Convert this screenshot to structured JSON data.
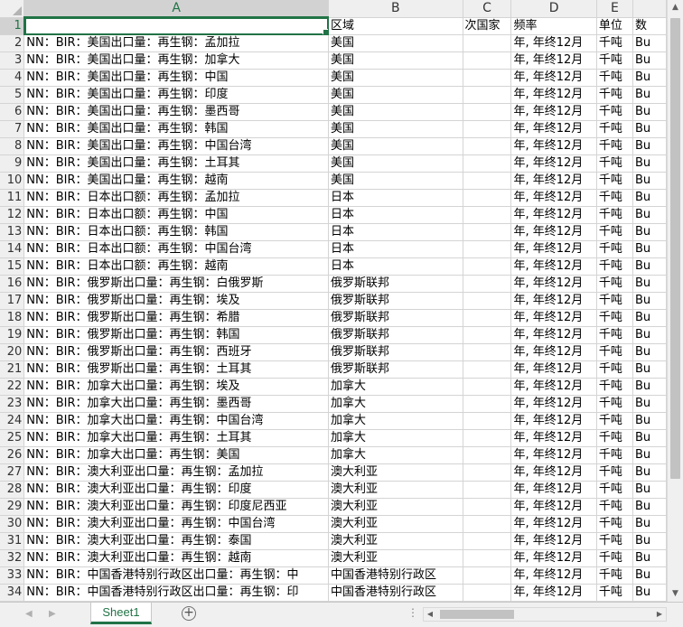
{
  "columns": [
    {
      "letter": "A",
      "active": true
    },
    {
      "letter": "B",
      "active": false
    },
    {
      "letter": "C",
      "active": false
    },
    {
      "letter": "D",
      "active": false
    },
    {
      "letter": "E",
      "active": false
    },
    {
      "letter": "",
      "active": false
    }
  ],
  "rows": [
    {
      "num": "1",
      "cells": [
        "",
        "区域",
        "次国家",
        "频率",
        "单位",
        "数"
      ]
    },
    {
      "num": "2",
      "cells": [
        "NN：BIR：美国出口量：再生钢：孟加拉",
        "美国",
        "",
        "年, 年终12月",
        "千吨",
        "Bu"
      ]
    },
    {
      "num": "3",
      "cells": [
        "NN：BIR：美国出口量：再生钢：加拿大",
        "美国",
        "",
        "年, 年终12月",
        "千吨",
        "Bu"
      ]
    },
    {
      "num": "4",
      "cells": [
        "NN：BIR：美国出口量：再生钢：中国",
        "美国",
        "",
        "年, 年终12月",
        "千吨",
        "Bu"
      ]
    },
    {
      "num": "5",
      "cells": [
        "NN：BIR：美国出口量：再生钢：印度",
        "美国",
        "",
        "年, 年终12月",
        "千吨",
        "Bu"
      ]
    },
    {
      "num": "6",
      "cells": [
        "NN：BIR：美国出口量：再生钢：墨西哥",
        "美国",
        "",
        "年, 年终12月",
        "千吨",
        "Bu"
      ]
    },
    {
      "num": "7",
      "cells": [
        "NN：BIR：美国出口量：再生钢：韩国",
        "美国",
        "",
        "年, 年终12月",
        "千吨",
        "Bu"
      ]
    },
    {
      "num": "8",
      "cells": [
        "NN：BIR：美国出口量：再生钢：中国台湾",
        "美国",
        "",
        "年, 年终12月",
        "千吨",
        "Bu"
      ]
    },
    {
      "num": "9",
      "cells": [
        "NN：BIR：美国出口量：再生钢：土耳其",
        "美国",
        "",
        "年, 年终12月",
        "千吨",
        "Bu"
      ]
    },
    {
      "num": "10",
      "cells": [
        "NN：BIR：美国出口量：再生钢：越南",
        "美国",
        "",
        "年, 年终12月",
        "千吨",
        "Bu"
      ]
    },
    {
      "num": "11",
      "cells": [
        "NN：BIR：日本出口额：再生钢：孟加拉",
        "日本",
        "",
        "年, 年终12月",
        "千吨",
        "Bu"
      ]
    },
    {
      "num": "12",
      "cells": [
        "NN：BIR：日本出口额：再生钢：中国",
        "日本",
        "",
        "年, 年终12月",
        "千吨",
        "Bu"
      ]
    },
    {
      "num": "13",
      "cells": [
        "NN：BIR：日本出口额：再生钢：韩国",
        "日本",
        "",
        "年, 年终12月",
        "千吨",
        "Bu"
      ]
    },
    {
      "num": "14",
      "cells": [
        "NN：BIR：日本出口额：再生钢：中国台湾",
        "日本",
        "",
        "年, 年终12月",
        "千吨",
        "Bu"
      ]
    },
    {
      "num": "15",
      "cells": [
        "NN：BIR：日本出口额：再生钢：越南",
        "日本",
        "",
        "年, 年终12月",
        "千吨",
        "Bu"
      ]
    },
    {
      "num": "16",
      "cells": [
        "NN：BIR：俄罗斯出口量：再生钢：白俄罗斯",
        "俄罗斯联邦",
        "",
        "年, 年终12月",
        "千吨",
        "Bu"
      ]
    },
    {
      "num": "17",
      "cells": [
        "NN：BIR：俄罗斯出口量：再生钢：埃及",
        "俄罗斯联邦",
        "",
        "年, 年终12月",
        "千吨",
        "Bu"
      ]
    },
    {
      "num": "18",
      "cells": [
        "NN：BIR：俄罗斯出口量：再生钢：希腊",
        "俄罗斯联邦",
        "",
        "年, 年终12月",
        "千吨",
        "Bu"
      ]
    },
    {
      "num": "19",
      "cells": [
        "NN：BIR：俄罗斯出口量：再生钢：韩国",
        "俄罗斯联邦",
        "",
        "年, 年终12月",
        "千吨",
        "Bu"
      ]
    },
    {
      "num": "20",
      "cells": [
        "NN：BIR：俄罗斯出口量：再生钢：西班牙",
        "俄罗斯联邦",
        "",
        "年, 年终12月",
        "千吨",
        "Bu"
      ]
    },
    {
      "num": "21",
      "cells": [
        "NN：BIR：俄罗斯出口量：再生钢：土耳其",
        "俄罗斯联邦",
        "",
        "年, 年终12月",
        "千吨",
        "Bu"
      ]
    },
    {
      "num": "22",
      "cells": [
        "NN：BIR：加拿大出口量：再生钢：埃及",
        "加拿大",
        "",
        "年, 年终12月",
        "千吨",
        "Bu"
      ]
    },
    {
      "num": "23",
      "cells": [
        "NN：BIR：加拿大出口量：再生钢：墨西哥",
        "加拿大",
        "",
        "年, 年终12月",
        "千吨",
        "Bu"
      ]
    },
    {
      "num": "24",
      "cells": [
        "NN：BIR：加拿大出口量：再生钢：中国台湾",
        "加拿大",
        "",
        "年, 年终12月",
        "千吨",
        "Bu"
      ]
    },
    {
      "num": "25",
      "cells": [
        "NN：BIR：加拿大出口量：再生钢：土耳其",
        "加拿大",
        "",
        "年, 年终12月",
        "千吨",
        "Bu"
      ]
    },
    {
      "num": "26",
      "cells": [
        "NN：BIR：加拿大出口量：再生钢：美国",
        "加拿大",
        "",
        "年, 年终12月",
        "千吨",
        "Bu"
      ]
    },
    {
      "num": "27",
      "cells": [
        "NN：BIR：澳大利亚出口量：再生钢：孟加拉",
        "澳大利亚",
        "",
        "年, 年终12月",
        "千吨",
        "Bu"
      ]
    },
    {
      "num": "28",
      "cells": [
        "NN：BIR：澳大利亚出口量：再生钢：印度",
        "澳大利亚",
        "",
        "年, 年终12月",
        "千吨",
        "Bu"
      ]
    },
    {
      "num": "29",
      "cells": [
        "NN：BIR：澳大利亚出口量：再生钢：印度尼西亚",
        "澳大利亚",
        "",
        "年, 年终12月",
        "千吨",
        "Bu"
      ]
    },
    {
      "num": "30",
      "cells": [
        "NN：BIR：澳大利亚出口量：再生钢：中国台湾",
        "澳大利亚",
        "",
        "年, 年终12月",
        "千吨",
        "Bu"
      ]
    },
    {
      "num": "31",
      "cells": [
        "NN：BIR：澳大利亚出口量：再生钢：泰国",
        "澳大利亚",
        "",
        "年, 年终12月",
        "千吨",
        "Bu"
      ]
    },
    {
      "num": "32",
      "cells": [
        "NN：BIR：澳大利亚出口量：再生钢：越南",
        "澳大利亚",
        "",
        "年, 年终12月",
        "千吨",
        "Bu"
      ]
    },
    {
      "num": "33",
      "cells": [
        "NN：BIR：中国香港特别行政区出口量：再生钢：中",
        "中国香港特别行政区",
        "",
        "年, 年终12月",
        "千吨",
        "Bu"
      ]
    },
    {
      "num": "34",
      "cells": [
        "NN：BIR：中国香港特别行政区出口量：再生钢：印",
        "中国香港特别行政区",
        "",
        "年, 年终12月",
        "千吨",
        "Bu"
      ]
    }
  ],
  "sheet_tabs": [
    {
      "label": "Sheet1",
      "active": true
    }
  ],
  "icons": {
    "add_sheet": "plus-icon",
    "scroll_up": "triangle-up-icon",
    "scroll_down": "triangle-down-icon",
    "scroll_left": "triangle-left-icon",
    "scroll_right": "triangle-right-icon"
  },
  "colors": {
    "accent": "#217346",
    "header_bg": "#efefef",
    "gridline": "#d4d4d4"
  }
}
